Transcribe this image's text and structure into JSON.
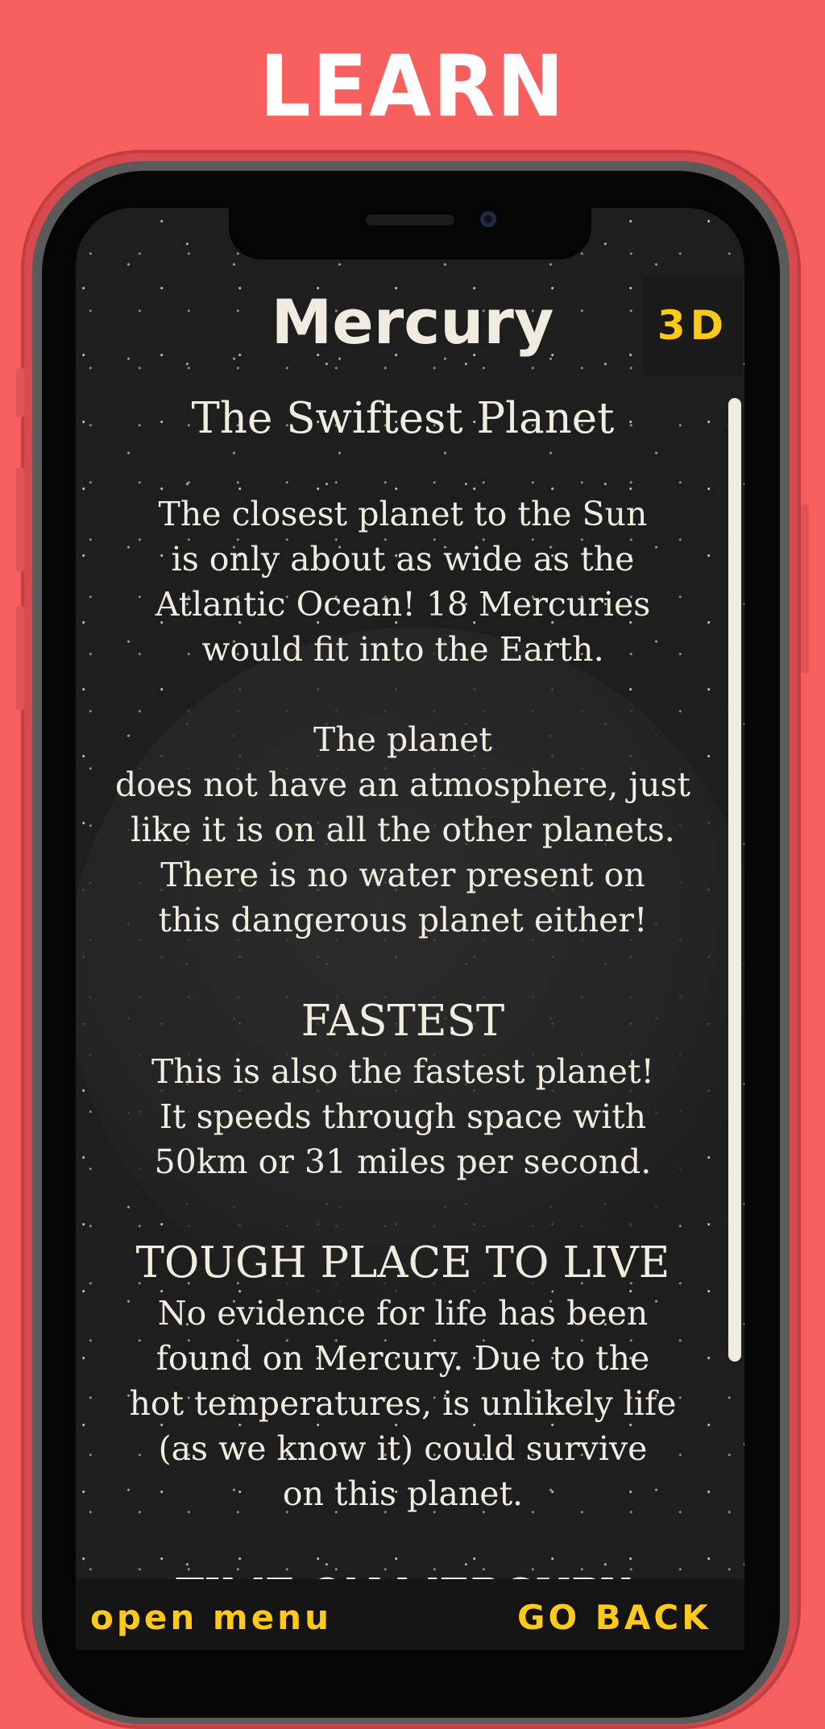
{
  "banner_title": "LEARN",
  "planet": {
    "title": "Mercury",
    "view_3d_label": "3D"
  },
  "article": {
    "heading": "The Swiftest Planet",
    "paragraph_1": [
      "The closest planet to the Sun",
      "is only about as wide as the",
      "Atlantic Ocean! 18 Mercuries",
      "would fit into the Earth."
    ],
    "paragraph_2": [
      "The planet",
      "does not have an atmosphere, just",
      "like it is on all the other planets.",
      "There is no water present on",
      "this dangerous planet either!"
    ],
    "section_fastest": {
      "heading": "FASTEST",
      "lines": [
        "This is also the fastest planet!",
        "It speeds through space with",
        "50km or 31 miles per second."
      ]
    },
    "section_tough": {
      "heading": "TOUGH PLACE TO LIVE",
      "lines": [
        "No evidence for life has been",
        "found on Mercury. Due to the",
        "hot temperatures, is unlikely life",
        "(as we know it) could survive",
        "on this planet."
      ]
    },
    "section_time": {
      "heading": "TIME ON MERCURY"
    }
  },
  "footer": {
    "open_menu_label": "open menu",
    "go_back_label": "GO BACK"
  },
  "colors": {
    "background": "#f75e5e",
    "accent_yellow": "#ffc917",
    "text_cream": "#efebe0",
    "screen_dark": "#1e1e1e"
  },
  "icons": [
    "notch-speaker",
    "front-camera"
  ]
}
